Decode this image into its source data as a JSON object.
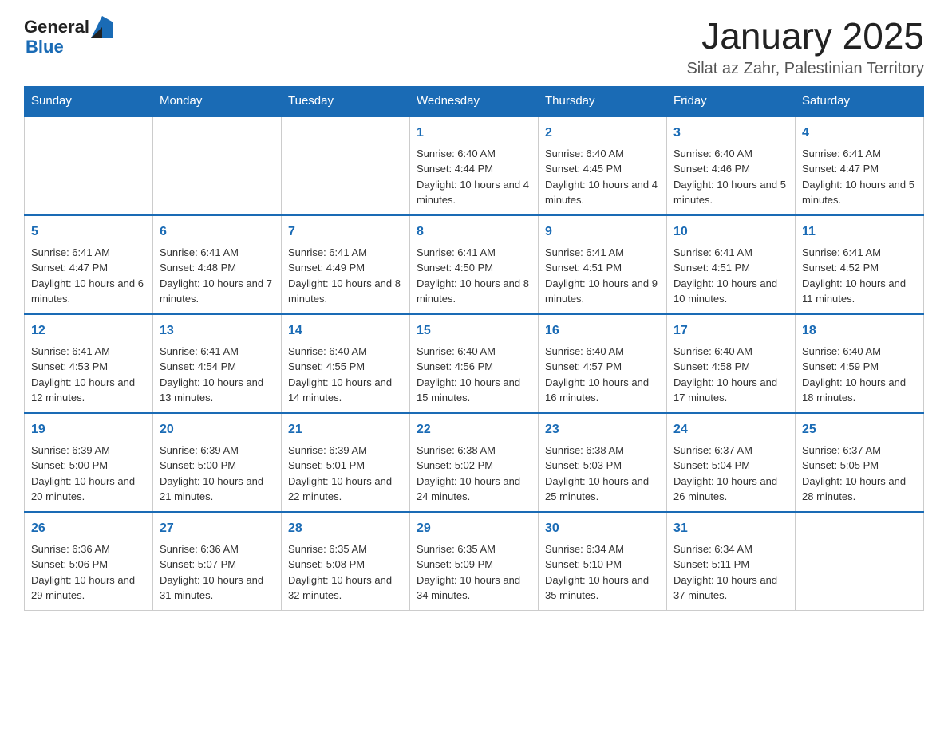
{
  "logo": {
    "text_general": "General",
    "text_blue": "Blue"
  },
  "header": {
    "title": "January 2025",
    "subtitle": "Silat az Zahr, Palestinian Territory"
  },
  "days_of_week": [
    "Sunday",
    "Monday",
    "Tuesday",
    "Wednesday",
    "Thursday",
    "Friday",
    "Saturday"
  ],
  "weeks": [
    [
      {
        "day": "",
        "info": ""
      },
      {
        "day": "",
        "info": ""
      },
      {
        "day": "",
        "info": ""
      },
      {
        "day": "1",
        "info": "Sunrise: 6:40 AM\nSunset: 4:44 PM\nDaylight: 10 hours and 4 minutes."
      },
      {
        "day": "2",
        "info": "Sunrise: 6:40 AM\nSunset: 4:45 PM\nDaylight: 10 hours and 4 minutes."
      },
      {
        "day": "3",
        "info": "Sunrise: 6:40 AM\nSunset: 4:46 PM\nDaylight: 10 hours and 5 minutes."
      },
      {
        "day": "4",
        "info": "Sunrise: 6:41 AM\nSunset: 4:47 PM\nDaylight: 10 hours and 5 minutes."
      }
    ],
    [
      {
        "day": "5",
        "info": "Sunrise: 6:41 AM\nSunset: 4:47 PM\nDaylight: 10 hours and 6 minutes."
      },
      {
        "day": "6",
        "info": "Sunrise: 6:41 AM\nSunset: 4:48 PM\nDaylight: 10 hours and 7 minutes."
      },
      {
        "day": "7",
        "info": "Sunrise: 6:41 AM\nSunset: 4:49 PM\nDaylight: 10 hours and 8 minutes."
      },
      {
        "day": "8",
        "info": "Sunrise: 6:41 AM\nSunset: 4:50 PM\nDaylight: 10 hours and 8 minutes."
      },
      {
        "day": "9",
        "info": "Sunrise: 6:41 AM\nSunset: 4:51 PM\nDaylight: 10 hours and 9 minutes."
      },
      {
        "day": "10",
        "info": "Sunrise: 6:41 AM\nSunset: 4:51 PM\nDaylight: 10 hours and 10 minutes."
      },
      {
        "day": "11",
        "info": "Sunrise: 6:41 AM\nSunset: 4:52 PM\nDaylight: 10 hours and 11 minutes."
      }
    ],
    [
      {
        "day": "12",
        "info": "Sunrise: 6:41 AM\nSunset: 4:53 PM\nDaylight: 10 hours and 12 minutes."
      },
      {
        "day": "13",
        "info": "Sunrise: 6:41 AM\nSunset: 4:54 PM\nDaylight: 10 hours and 13 minutes."
      },
      {
        "day": "14",
        "info": "Sunrise: 6:40 AM\nSunset: 4:55 PM\nDaylight: 10 hours and 14 minutes."
      },
      {
        "day": "15",
        "info": "Sunrise: 6:40 AM\nSunset: 4:56 PM\nDaylight: 10 hours and 15 minutes."
      },
      {
        "day": "16",
        "info": "Sunrise: 6:40 AM\nSunset: 4:57 PM\nDaylight: 10 hours and 16 minutes."
      },
      {
        "day": "17",
        "info": "Sunrise: 6:40 AM\nSunset: 4:58 PM\nDaylight: 10 hours and 17 minutes."
      },
      {
        "day": "18",
        "info": "Sunrise: 6:40 AM\nSunset: 4:59 PM\nDaylight: 10 hours and 18 minutes."
      }
    ],
    [
      {
        "day": "19",
        "info": "Sunrise: 6:39 AM\nSunset: 5:00 PM\nDaylight: 10 hours and 20 minutes."
      },
      {
        "day": "20",
        "info": "Sunrise: 6:39 AM\nSunset: 5:00 PM\nDaylight: 10 hours and 21 minutes."
      },
      {
        "day": "21",
        "info": "Sunrise: 6:39 AM\nSunset: 5:01 PM\nDaylight: 10 hours and 22 minutes."
      },
      {
        "day": "22",
        "info": "Sunrise: 6:38 AM\nSunset: 5:02 PM\nDaylight: 10 hours and 24 minutes."
      },
      {
        "day": "23",
        "info": "Sunrise: 6:38 AM\nSunset: 5:03 PM\nDaylight: 10 hours and 25 minutes."
      },
      {
        "day": "24",
        "info": "Sunrise: 6:37 AM\nSunset: 5:04 PM\nDaylight: 10 hours and 26 minutes."
      },
      {
        "day": "25",
        "info": "Sunrise: 6:37 AM\nSunset: 5:05 PM\nDaylight: 10 hours and 28 minutes."
      }
    ],
    [
      {
        "day": "26",
        "info": "Sunrise: 6:36 AM\nSunset: 5:06 PM\nDaylight: 10 hours and 29 minutes."
      },
      {
        "day": "27",
        "info": "Sunrise: 6:36 AM\nSunset: 5:07 PM\nDaylight: 10 hours and 31 minutes."
      },
      {
        "day": "28",
        "info": "Sunrise: 6:35 AM\nSunset: 5:08 PM\nDaylight: 10 hours and 32 minutes."
      },
      {
        "day": "29",
        "info": "Sunrise: 6:35 AM\nSunset: 5:09 PM\nDaylight: 10 hours and 34 minutes."
      },
      {
        "day": "30",
        "info": "Sunrise: 6:34 AM\nSunset: 5:10 PM\nDaylight: 10 hours and 35 minutes."
      },
      {
        "day": "31",
        "info": "Sunrise: 6:34 AM\nSunset: 5:11 PM\nDaylight: 10 hours and 37 minutes."
      },
      {
        "day": "",
        "info": ""
      }
    ]
  ]
}
